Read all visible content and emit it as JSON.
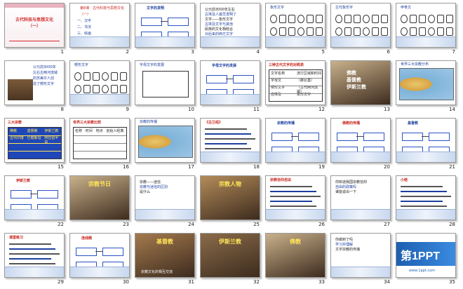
{
  "slides": [
    {
      "n": "1",
      "kind": "title",
      "title": "古代科技与思想文化",
      "subtitle": "（一）"
    },
    {
      "n": "2",
      "kind": "outline",
      "lines": [
        "第8课　古代科技与思想文化",
        "（一）",
        "一、汉字",
        "二、书法",
        "三、绘画",
        "四、文学"
      ]
    },
    {
      "n": "3",
      "kind": "diagram",
      "title": "文字的发明"
    },
    {
      "n": "4",
      "kind": "text",
      "lines": [
        "公元前3000年左右",
        "古埃及人最早发明了",
        "文字——象形文字",
        "古埃及文字与其他",
        "民族的文化相结合",
        "对后来的西方文字",
        "产生了重要影响"
      ]
    },
    {
      "n": "5",
      "kind": "glyphs",
      "title": "象形文字"
    },
    {
      "n": "6",
      "kind": "glyphs",
      "title": "古代象形字"
    },
    {
      "n": "7",
      "kind": "glyphs",
      "title": "甲骨文"
    },
    {
      "n": "8",
      "kind": "stone",
      "lines": [
        "公元前3000年",
        "左右古两河流域",
        "的苏美尔人创",
        "造了楔形文字"
      ]
    },
    {
      "n": "9",
      "kind": "glyphs",
      "title": "楔形文字"
    },
    {
      "n": "10",
      "kind": "chart",
      "title": "字母文字的发展"
    },
    {
      "n": "11",
      "kind": "diagram",
      "title": "字母文字的发展"
    },
    {
      "n": "12",
      "kind": "table",
      "title": "三种古代文字的对照表",
      "rows": [
        [
          "文字名称",
          "流行区域和时间"
        ],
        [
          "字母文",
          "（腓尼基）"
        ],
        [
          "楔形文字",
          "（古代两河流域）"
        ],
        [
          "古埃及",
          "象形文字"
        ]
      ]
    },
    {
      "n": "13",
      "kind": "photo",
      "lines": [
        "佛教",
        "基督教",
        "伊斯兰教"
      ]
    },
    {
      "n": "14",
      "kind": "map",
      "title": "世界三大宗教分布"
    },
    {
      "n": "15",
      "kind": "table",
      "title": "三大宗教",
      "rows": [
        [
          "佛教",
          "基督教",
          "伊斯兰教"
        ],
        [
          "古代印度",
          "巴勒斯坦",
          "阿拉伯半岛"
        ]
      ]
    },
    {
      "n": "16",
      "kind": "table",
      "title": "世界三大宗教比较",
      "rows": [
        [
          "名称",
          "时间",
          "地点",
          "创始人",
          "经典"
        ]
      ]
    },
    {
      "n": "17",
      "kind": "map",
      "title": "宗教的传播"
    },
    {
      "n": "18",
      "kind": "text",
      "title": "《古兰经》"
    },
    {
      "n": "19",
      "kind": "diagram",
      "title": "宗教的传播"
    },
    {
      "n": "20",
      "kind": "diagram",
      "title": "佛教的传播"
    },
    {
      "n": "21",
      "kind": "diagram",
      "title": "基督教"
    },
    {
      "n": "22",
      "kind": "diagram",
      "title": "伊斯兰教"
    },
    {
      "n": "23",
      "kind": "photo",
      "title": "宗教节日"
    },
    {
      "n": "24",
      "kind": "text",
      "lines": [
        "宗教——迷信",
        "宗教与迷信的区别",
        "是什么"
      ]
    },
    {
      "n": "25",
      "kind": "photo",
      "title": "宗教人物"
    },
    {
      "n": "26",
      "kind": "text",
      "title": "宗教信仰自由"
    },
    {
      "n": "27",
      "kind": "text",
      "lines": [
        "你知道我国宗教信仰",
        "自由的政策吗",
        "谁能说出一下"
      ]
    },
    {
      "n": "28",
      "kind": "text",
      "title": "小结"
    },
    {
      "n": "29",
      "kind": "text",
      "title": "课堂练习"
    },
    {
      "n": "30",
      "kind": "diagram",
      "title": "连线题"
    },
    {
      "n": "31",
      "kind": "photo",
      "title": "基督教",
      "caption": "宗教文化的相互交流"
    },
    {
      "n": "32",
      "kind": "photo",
      "title": "伊斯兰教"
    },
    {
      "n": "33",
      "kind": "photo",
      "title": "佛教"
    },
    {
      "n": "34",
      "kind": "text",
      "lines": [
        "你做到了吗",
        "学习并理解",
        "文字宗教的传播"
      ]
    },
    {
      "n": "35",
      "kind": "logo",
      "brand": "第1PPT",
      "url": "www.1ppt.com"
    }
  ]
}
